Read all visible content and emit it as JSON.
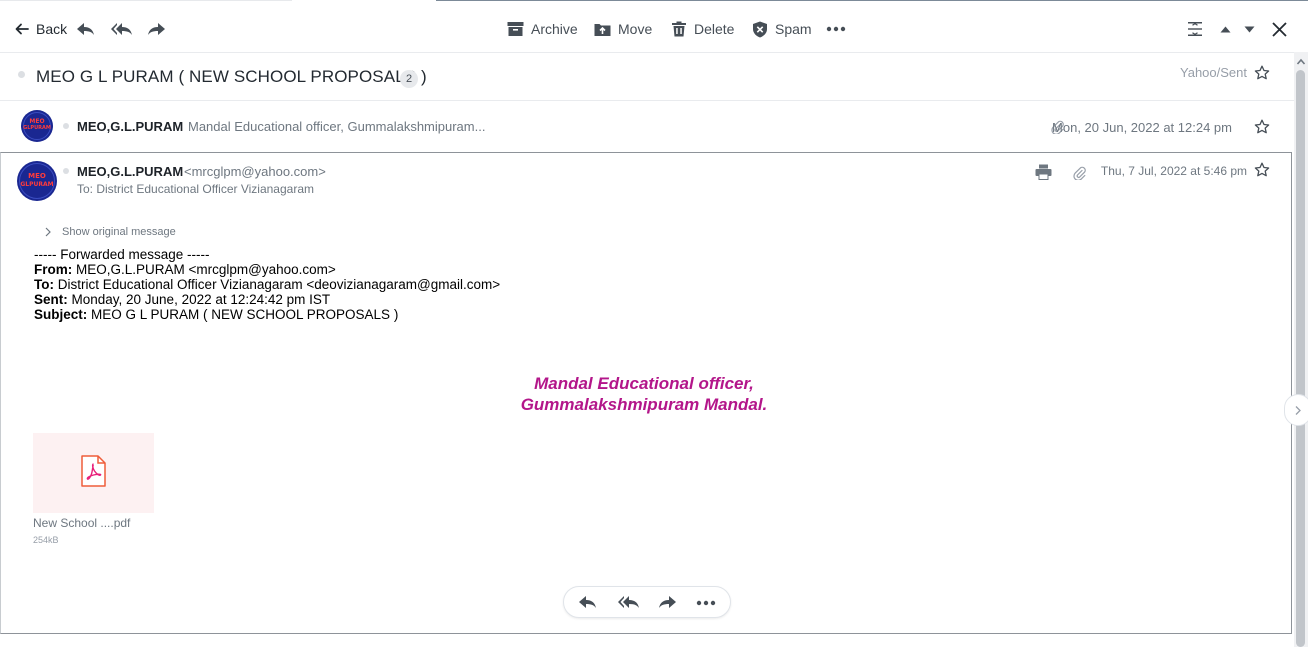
{
  "toolbar": {
    "back_label": "Back",
    "archive_label": "Archive",
    "move_label": "Move",
    "delete_label": "Delete",
    "spam_label": "Spam"
  },
  "thread": {
    "subject": "MEO G L PURAM ( NEW SCHOOL PROPOSALS )",
    "count": "2",
    "folder": "Yahoo/Sent"
  },
  "avatar": {
    "line1": "MEO",
    "line2": "GLPURAM"
  },
  "message1": {
    "sender": "MEO,G.L.PURAM",
    "snippet": "Mandal Educational officer, Gummalakshmipuram...",
    "date": "Mon, 20 Jun, 2022 at 12:24 pm"
  },
  "message2": {
    "sender": "MEO,G.L.PURAM",
    "email": "<mrcglpm@yahoo.com>",
    "to": "To: District Educational Officer Vizianagaram",
    "date": "Thu, 7 Jul, 2022 at 5:46 pm",
    "show_original": "Show original message",
    "forward_header": "----- Forwarded message -----",
    "from_label": "From:",
    "from_value": " MEO,G.L.PURAM <mrcglpm@yahoo.com>",
    "to_label": "To:",
    "to_value": " District Educational Officer Vizianagaram <deovizianagaram@gmail.com>",
    "sent_label": "Sent:",
    "sent_value": " Monday, 20 June, 2022 at 12:24:42 pm IST",
    "subject_label": "Subject:",
    "subject_value": " MEO G L PURAM ( NEW SCHOOL PROPOSALS )",
    "signature_line1": "Mandal Educational officer,",
    "signature_line2": "Gummalakshmipuram Mandal.",
    "attachment_name": "New School ....pdf",
    "attachment_size": "254kB"
  },
  "colors": {
    "signature": "#b3168a",
    "avatar_bg": "#1a2791",
    "avatar_text": "#ff3b3b",
    "icon": "#464e56"
  }
}
